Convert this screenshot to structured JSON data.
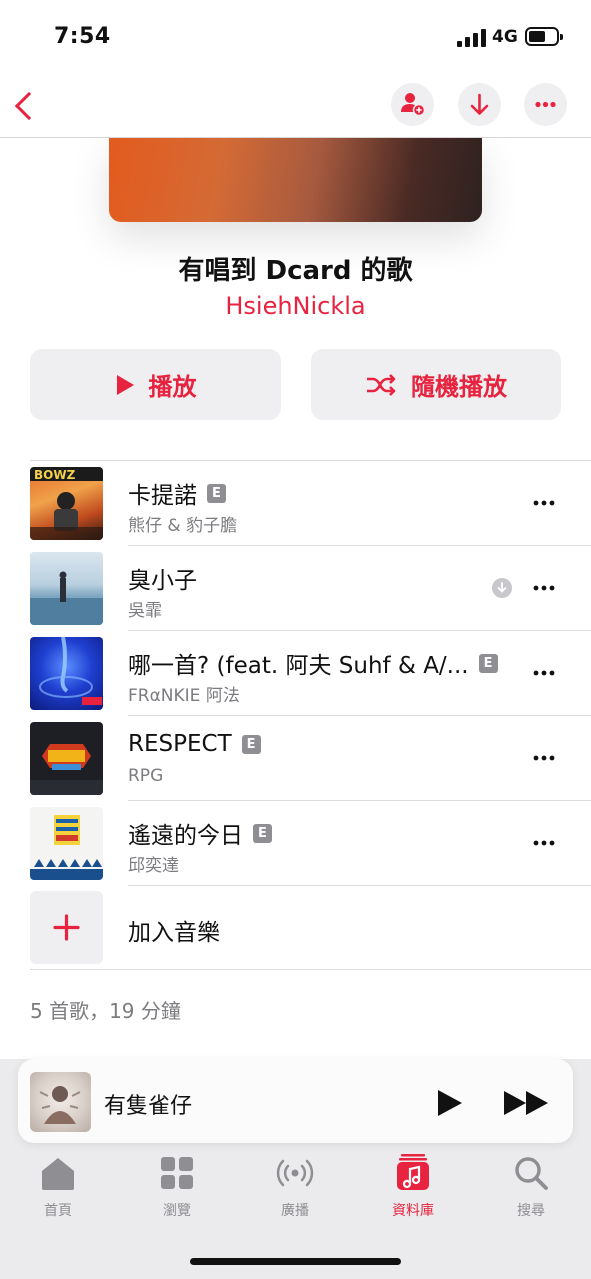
{
  "status_bar": {
    "time": "7:54",
    "network": "4G"
  },
  "nav": {
    "back_icon": "chevron-left-icon",
    "actions": [
      "add-person-icon",
      "download-icon",
      "more-icon"
    ]
  },
  "playlist": {
    "title": "有唱到 Dcard 的歌",
    "owner": "HsiehNickla",
    "play_label": "播放",
    "shuffle_label": "隨機播放"
  },
  "tracks": [
    {
      "title": "卡提諾",
      "artist": "熊仔 & 豹子膽",
      "explicit": true,
      "downloaded_icon": false
    },
    {
      "title": "臭小子",
      "artist": "吳霏",
      "explicit": false,
      "downloaded_icon": true
    },
    {
      "title": "哪一首? (feat. 阿夫 Suhf & A/...",
      "artist": "FRαNKIE 阿法",
      "explicit": true,
      "downloaded_icon": false
    },
    {
      "title": "RESPECT",
      "artist": "RPG",
      "explicit": true,
      "downloaded_icon": false
    },
    {
      "title": "遙遠的今日",
      "artist": "邱奕達",
      "explicit": true,
      "downloaded_icon": false
    }
  ],
  "explicit_badge": "E",
  "add_music_label": "加入音樂",
  "summary": "5 首歌，19 分鐘",
  "mini_player": {
    "title": "有隻雀仔"
  },
  "tabs": [
    {
      "label": "首頁",
      "icon": "home-icon",
      "active": false
    },
    {
      "label": "瀏覽",
      "icon": "browse-grid-icon",
      "active": false
    },
    {
      "label": "廣播",
      "icon": "radio-icon",
      "active": false
    },
    {
      "label": "資料庫",
      "icon": "library-icon",
      "active": true
    },
    {
      "label": "搜尋",
      "icon": "search-icon",
      "active": false
    }
  ],
  "colors": {
    "accent": "#e8233f",
    "secondary_text": "#7c7c80",
    "button_bg": "#efeff1"
  }
}
